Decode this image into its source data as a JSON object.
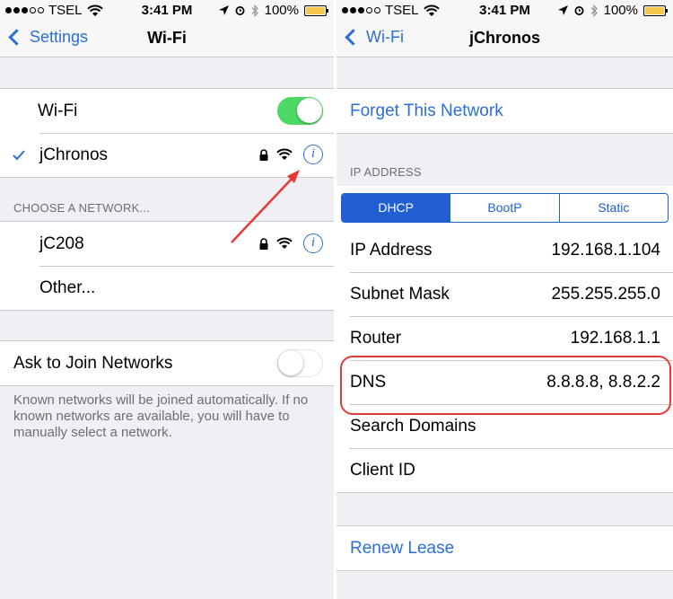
{
  "left": {
    "status": {
      "carrier": "TSEL",
      "time": "3:41 PM",
      "battery": "100%"
    },
    "nav": {
      "back_label": "Settings",
      "title": "Wi-Fi"
    },
    "wifi_toggle_label": "Wi-Fi",
    "wifi_on": true,
    "connected_network": "jChronos",
    "choose_header": "CHOOSE A NETWORK...",
    "networks": [
      "jC208",
      "Other..."
    ],
    "ask_join_label": "Ask to Join Networks",
    "ask_join_on": false,
    "ask_join_footer": "Known networks will be joined automatically. If no known networks are available, you will have to manually select a network."
  },
  "right": {
    "status": {
      "carrier": "TSEL",
      "time": "3:41 PM",
      "battery": "100%"
    },
    "nav": {
      "back_label": "Wi-Fi",
      "title": "jChronos"
    },
    "forget_label": "Forget This Network",
    "ip_header": "IP ADDRESS",
    "segments": [
      "DHCP",
      "BootP",
      "Static"
    ],
    "selected_segment": "DHCP",
    "rows": [
      {
        "label": "IP Address",
        "value": "192.168.1.104"
      },
      {
        "label": "Subnet Mask",
        "value": "255.255.255.0"
      },
      {
        "label": "Router",
        "value": "192.168.1.1"
      },
      {
        "label": "DNS",
        "value": "8.8.8.8, 8.8.2.2"
      },
      {
        "label": "Search Domains",
        "value": ""
      },
      {
        "label": "Client ID",
        "value": ""
      }
    ],
    "renew_label": "Renew Lease"
  },
  "colors": {
    "ios_blue": "#2b6fd6",
    "segment_blue": "#1f5fd1",
    "toggle_green": "#4cd964",
    "annotation_red": "#e53935"
  },
  "icons": [
    "chevron-left-icon",
    "checkmark-icon",
    "lock-icon",
    "wifi-signal-icon",
    "info-icon",
    "location-arrow-icon",
    "alarm-icon",
    "bluetooth-icon",
    "battery-icon"
  ]
}
